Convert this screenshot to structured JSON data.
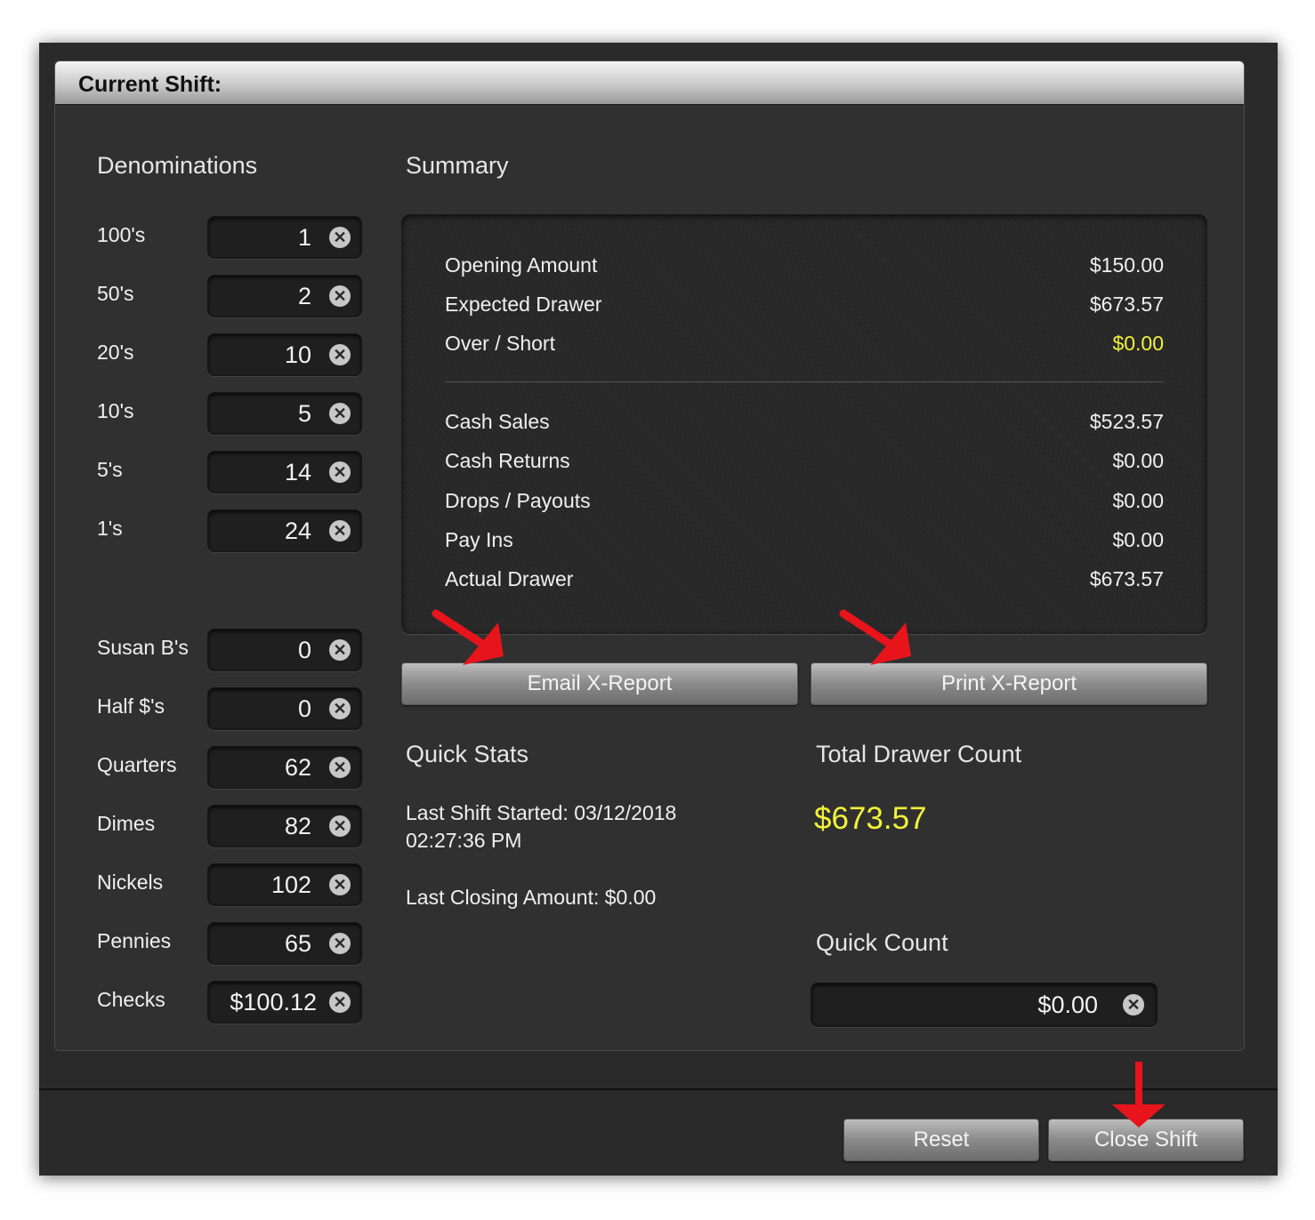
{
  "panel": {
    "title": "Current Shift:"
  },
  "denominations": {
    "heading": "Denominations",
    "bills": [
      {
        "label": "100's",
        "value": "1"
      },
      {
        "label": "50's",
        "value": "2"
      },
      {
        "label": "20's",
        "value": "10"
      },
      {
        "label": "10's",
        "value": "5"
      },
      {
        "label": "5's",
        "value": "14"
      },
      {
        "label": "1's",
        "value": "24"
      }
    ],
    "coins": [
      {
        "label": "Susan B's",
        "value": "0"
      },
      {
        "label": "Half $'s",
        "value": "0"
      },
      {
        "label": "Quarters",
        "value": "62"
      },
      {
        "label": "Dimes",
        "value": "82"
      },
      {
        "label": "Nickels",
        "value": "102"
      },
      {
        "label": "Pennies",
        "value": "65"
      },
      {
        "label": "Checks",
        "value": "$100.12"
      }
    ]
  },
  "summary": {
    "heading": "Summary",
    "top_rows": [
      {
        "label": "Opening Amount",
        "value": "$150.00"
      },
      {
        "label": "Expected Drawer",
        "value": "$673.57"
      },
      {
        "label": "Over / Short",
        "value": "$0.00"
      }
    ],
    "bottom_rows": [
      {
        "label": "Cash Sales",
        "value": "$523.57"
      },
      {
        "label": "Cash Returns",
        "value": "$0.00"
      },
      {
        "label": "Drops / Payouts",
        "value": "$0.00"
      },
      {
        "label": "Pay Ins",
        "value": "$0.00"
      },
      {
        "label": "Actual Drawer",
        "value": "$673.57"
      }
    ]
  },
  "buttons": {
    "email_x_report": "Email X-Report",
    "print_x_report": "Print X-Report",
    "reset": "Reset",
    "close_shift": "Close Shift"
  },
  "quick_stats": {
    "heading": "Quick Stats",
    "last_shift_started": "Last Shift Started: 03/12/2018 02:27:36 PM",
    "last_closing_amount": "Last Closing Amount: $0.00"
  },
  "total_drawer": {
    "heading": "Total Drawer Count",
    "value": "$673.57"
  },
  "quick_count": {
    "heading": "Quick Count",
    "value": "$0.00"
  },
  "colors": {
    "highlight_yellow": "#f2f23a",
    "annotation_arrow": "#e8141b"
  },
  "icons": {
    "clear": "x-circle-icon",
    "annotation": "red-arrow-icon"
  }
}
